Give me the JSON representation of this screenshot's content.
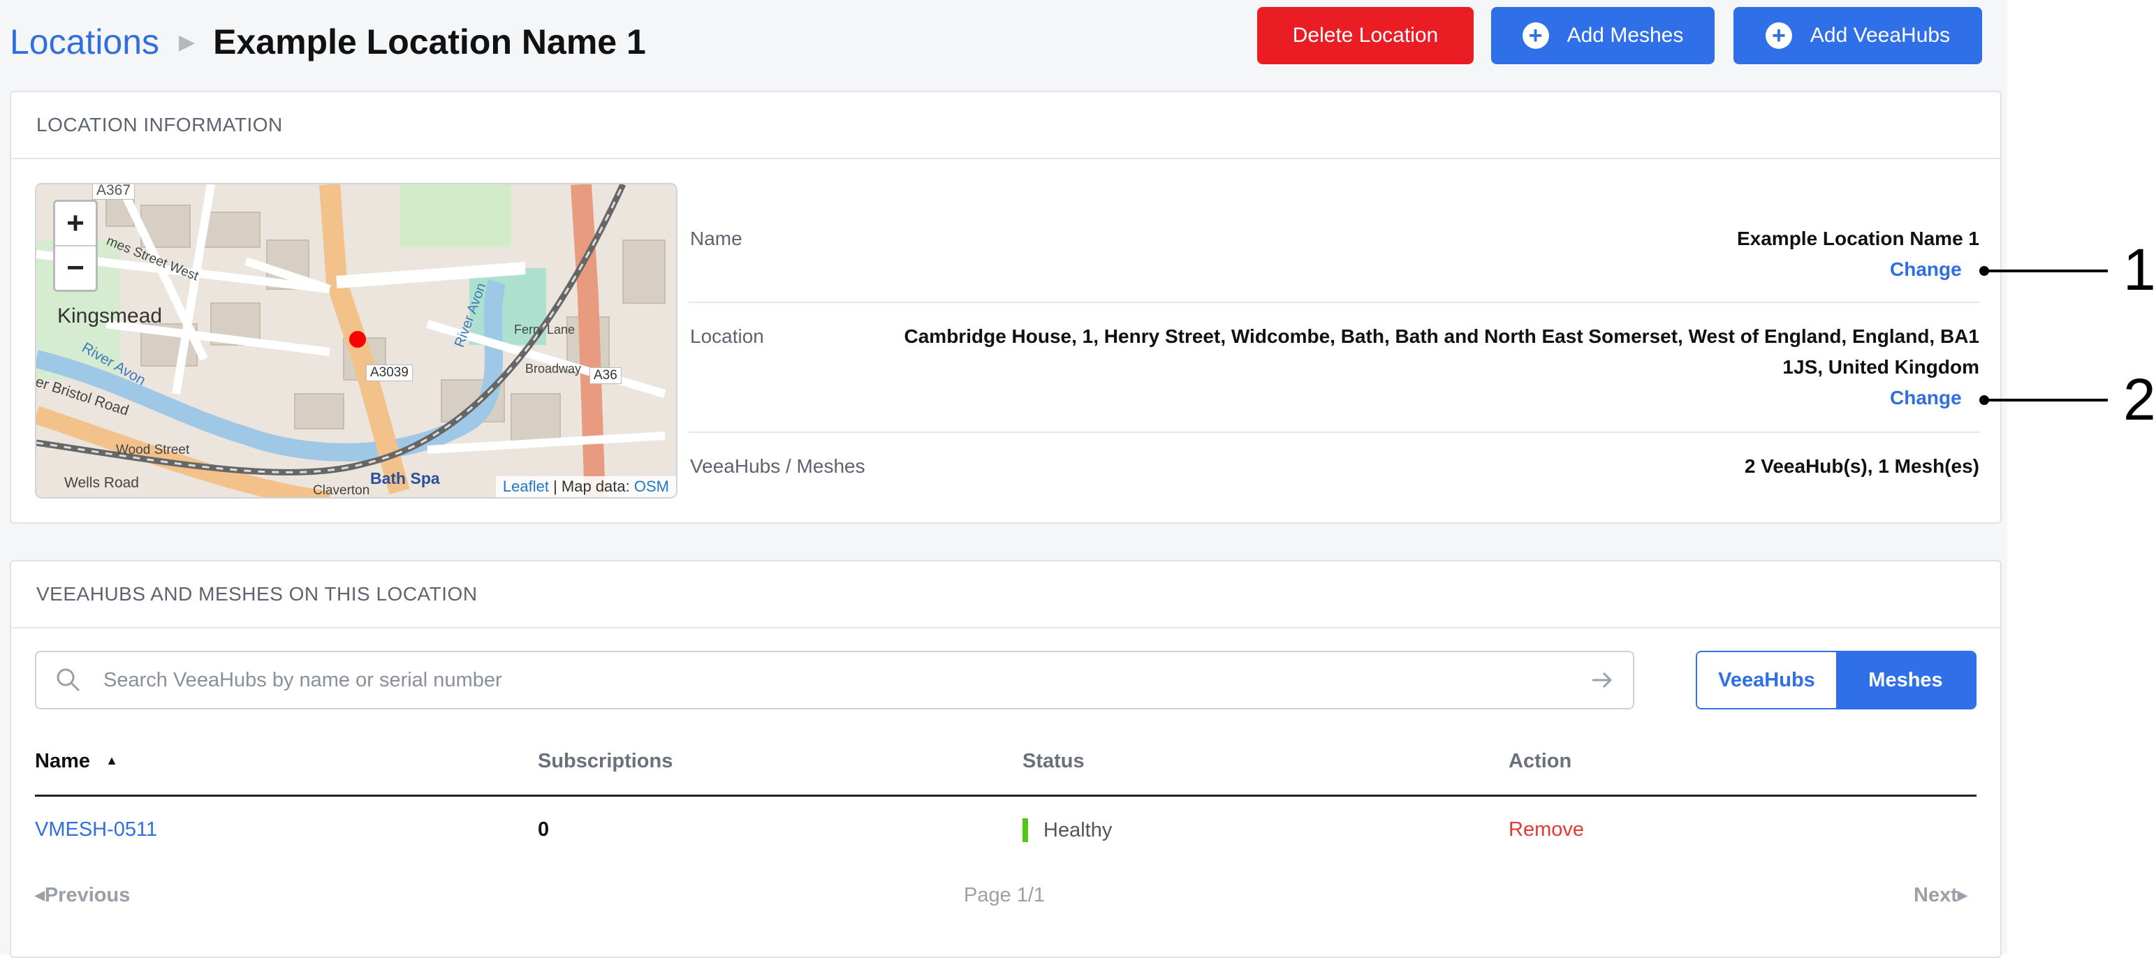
{
  "breadcrumb": {
    "parent": "Locations",
    "current": "Example Location Name 1"
  },
  "actions": {
    "delete": "Delete Location",
    "add_meshes": "Add Meshes",
    "add_veeahubs": "Add VeeaHubs"
  },
  "location_info": {
    "header": "LOCATION INFORMATION",
    "name_label": "Name",
    "name_value": "Example Location Name 1",
    "location_label": "Location",
    "location_line1": "Cambridge House, 1, Henry Street, Widcombe, Bath, Bath and North East Somerset, West of England, England, BA1",
    "location_line2": "1JS, United Kingdom",
    "change_label": "Change",
    "hubs_label": "VeeaHubs / Meshes",
    "hubs_value": "2 VeeaHub(s), 1 Mesh(es)"
  },
  "map": {
    "zoom_in": "+",
    "zoom_out": "−",
    "attribution": {
      "leaflet": "Leaflet",
      "separator": " | Map data: ",
      "osm": "OSM"
    },
    "labels": [
      "A367",
      "Kingsmead",
      "mes Street West",
      "River Avon",
      "er Bristol Road",
      "Wood Street",
      "Wells Road",
      "Claverton",
      "Bath Spa",
      "A3039",
      "A36",
      "Broadway",
      "Ferry Lane",
      "River Avon"
    ]
  },
  "hubs_section": {
    "header": "VEEAHUBS AND MESHES ON THIS LOCATION",
    "search_placeholder": "Search VeeaHubs by name or serial number",
    "toggle": {
      "veeahubs": "VeeaHubs",
      "meshes": "Meshes"
    },
    "columns": {
      "name": "Name",
      "subscriptions": "Subscriptions",
      "status": "Status",
      "action": "Action"
    },
    "rows": [
      {
        "name": "VMESH-0511",
        "subscriptions": "0",
        "status": "Healthy",
        "action": "Remove"
      }
    ],
    "pagination": {
      "previous": "Previous",
      "page": "Page 1/1",
      "next": "Next"
    }
  },
  "callouts": [
    "1",
    "2"
  ],
  "colors": {
    "primary": "#2f6fe8",
    "danger": "#ea1c24",
    "healthy": "#52c41a",
    "remove": "#e53935"
  }
}
